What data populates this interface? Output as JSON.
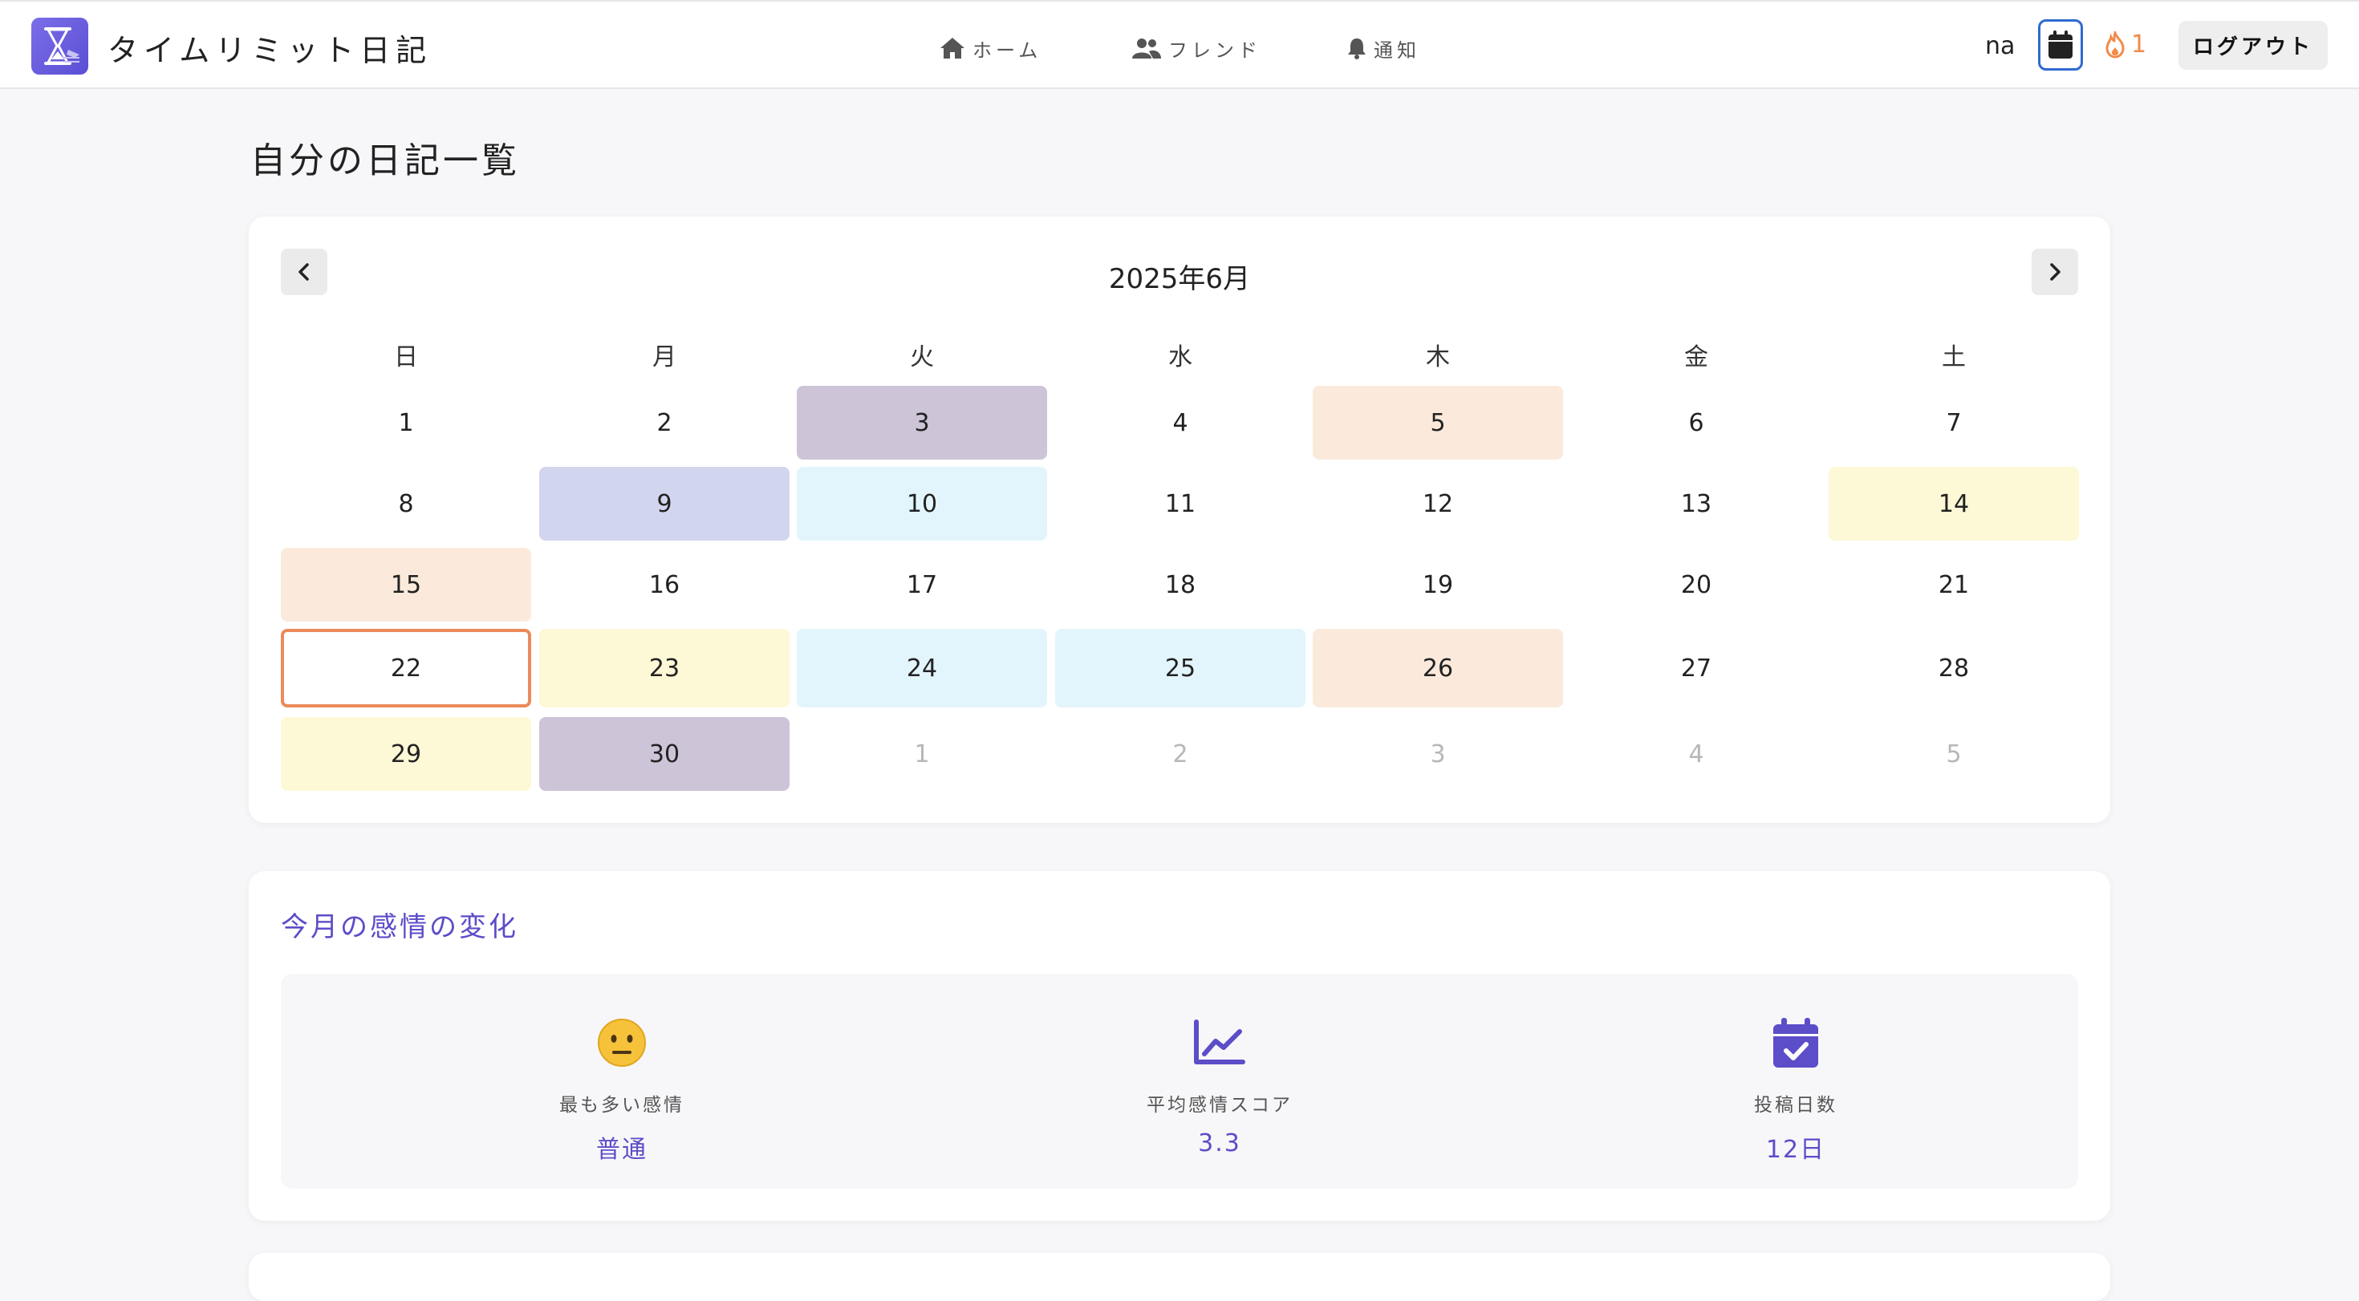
{
  "header": {
    "app_title": "タイムリミット日記",
    "nav": [
      {
        "label": "ホーム",
        "icon": "home-icon"
      },
      {
        "label": "フレンド",
        "icon": "friends-icon"
      },
      {
        "label": "通知",
        "icon": "bell-icon"
      }
    ],
    "user_name": "na",
    "streak_count": "1",
    "logout_label": "ログアウト"
  },
  "page_title": "自分の日記一覧",
  "calendar": {
    "month_label": "2025年6月",
    "weekdays": [
      "日",
      "月",
      "火",
      "水",
      "木",
      "金",
      "土"
    ],
    "days": [
      {
        "label": "1",
        "color": ""
      },
      {
        "label": "2",
        "color": ""
      },
      {
        "label": "3",
        "color": "#cdc4d8"
      },
      {
        "label": "4",
        "color": ""
      },
      {
        "label": "5",
        "color": "#fbeadb"
      },
      {
        "label": "6",
        "color": ""
      },
      {
        "label": "7",
        "color": ""
      },
      {
        "label": "8",
        "color": ""
      },
      {
        "label": "9",
        "color": "#d2d5ee"
      },
      {
        "label": "10",
        "color": "#e3f5fc"
      },
      {
        "label": "11",
        "color": ""
      },
      {
        "label": "12",
        "color": ""
      },
      {
        "label": "13",
        "color": ""
      },
      {
        "label": "14",
        "color": "#fdf8d6"
      },
      {
        "label": "15",
        "color": "#fbeadb"
      },
      {
        "label": "16",
        "color": ""
      },
      {
        "label": "17",
        "color": ""
      },
      {
        "label": "18",
        "color": ""
      },
      {
        "label": "19",
        "color": ""
      },
      {
        "label": "20",
        "color": ""
      },
      {
        "label": "21",
        "color": ""
      },
      {
        "label": "22",
        "color": "",
        "today": true
      },
      {
        "label": "23",
        "color": "#fdf8d6"
      },
      {
        "label": "24",
        "color": "#e3f5fc"
      },
      {
        "label": "25",
        "color": "#e3f5fc"
      },
      {
        "label": "26",
        "color": "#fbeadb"
      },
      {
        "label": "27",
        "color": ""
      },
      {
        "label": "28",
        "color": ""
      },
      {
        "label": "29",
        "color": "#fdf8d6"
      },
      {
        "label": "30",
        "color": "#cdc4d8"
      },
      {
        "label": "1",
        "color": "",
        "other": true
      },
      {
        "label": "2",
        "color": "",
        "other": true
      },
      {
        "label": "3",
        "color": "",
        "other": true
      },
      {
        "label": "4",
        "color": "",
        "other": true
      },
      {
        "label": "5",
        "color": "",
        "other": true
      }
    ]
  },
  "stats": {
    "title": "今月の感情の変化",
    "items": [
      {
        "label": "最も多い感情",
        "value": "普通",
        "icon": "neutral-face-icon"
      },
      {
        "label": "平均感情スコア",
        "value": "3.3",
        "icon": "line-chart-icon"
      },
      {
        "label": "投稿日数",
        "value": "12日",
        "icon": "calendar-check-icon"
      }
    ]
  },
  "colors": {
    "accent": "#5c4dc8",
    "today_border": "#ec8a5a",
    "streak": "#f28a4a",
    "calendar_button_border": "#2f6ad0"
  }
}
